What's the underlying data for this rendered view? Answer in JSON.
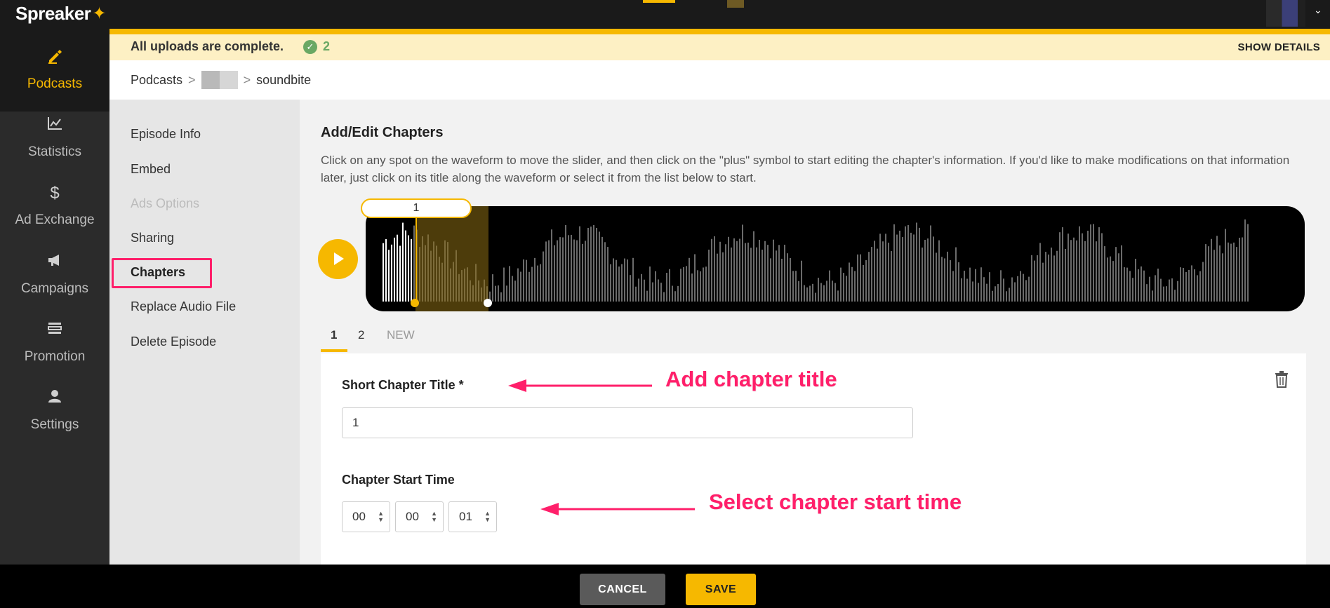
{
  "brand": {
    "name": "Spreaker",
    "star": "✦"
  },
  "leftnav": {
    "items": [
      {
        "label": "Podcasts",
        "icon": "pencil-icon",
        "glyph": "✎"
      },
      {
        "label": "Statistics",
        "icon": "chart-icon",
        "glyph": "📈"
      },
      {
        "label": "Ad Exchange",
        "icon": "dollar-icon",
        "glyph": "$"
      },
      {
        "label": "Campaigns",
        "icon": "megaphone-icon",
        "glyph": "📢"
      },
      {
        "label": "Promotion",
        "icon": "promotion-icon",
        "glyph": "▤"
      },
      {
        "label": "Settings",
        "icon": "user-icon",
        "glyph": "👤"
      }
    ]
  },
  "banner": {
    "message": "All uploads are complete.",
    "count": "2",
    "details": "SHOW DETAILS"
  },
  "breadcrumb": {
    "root": "Podcasts",
    "leaf": "soundbite"
  },
  "subnav": {
    "items": [
      {
        "label": "Episode Info"
      },
      {
        "label": "Embed"
      },
      {
        "label": "Ads Options"
      },
      {
        "label": "Sharing"
      },
      {
        "label": "Chapters"
      },
      {
        "label": "Replace Audio File"
      },
      {
        "label": "Delete Episode"
      }
    ]
  },
  "main": {
    "title": "Add/Edit Chapters",
    "description": "Click on any spot on the waveform to move the slider, and then click on the \"plus\" symbol to start editing the chapter's information. If you'd like to make modifications on that information later, just click on its title along the waveform or select it from the list below to start.",
    "waveform_label": "1",
    "tabs": [
      "1",
      "2",
      "NEW"
    ],
    "fields": {
      "title_label": "Short Chapter Title  *",
      "title_value": "1",
      "start_label": "Chapter Start Time",
      "hours": "00",
      "minutes": "00",
      "seconds": "01"
    }
  },
  "annotations": {
    "title_hint": "Add chapter title",
    "time_hint": "Select chapter start time"
  },
  "footer": {
    "cancel": "CANCEL",
    "save": "SAVE"
  },
  "colors": {
    "accent": "#f6b800",
    "highlight": "#ff1f6a",
    "success": "#6aa864"
  }
}
